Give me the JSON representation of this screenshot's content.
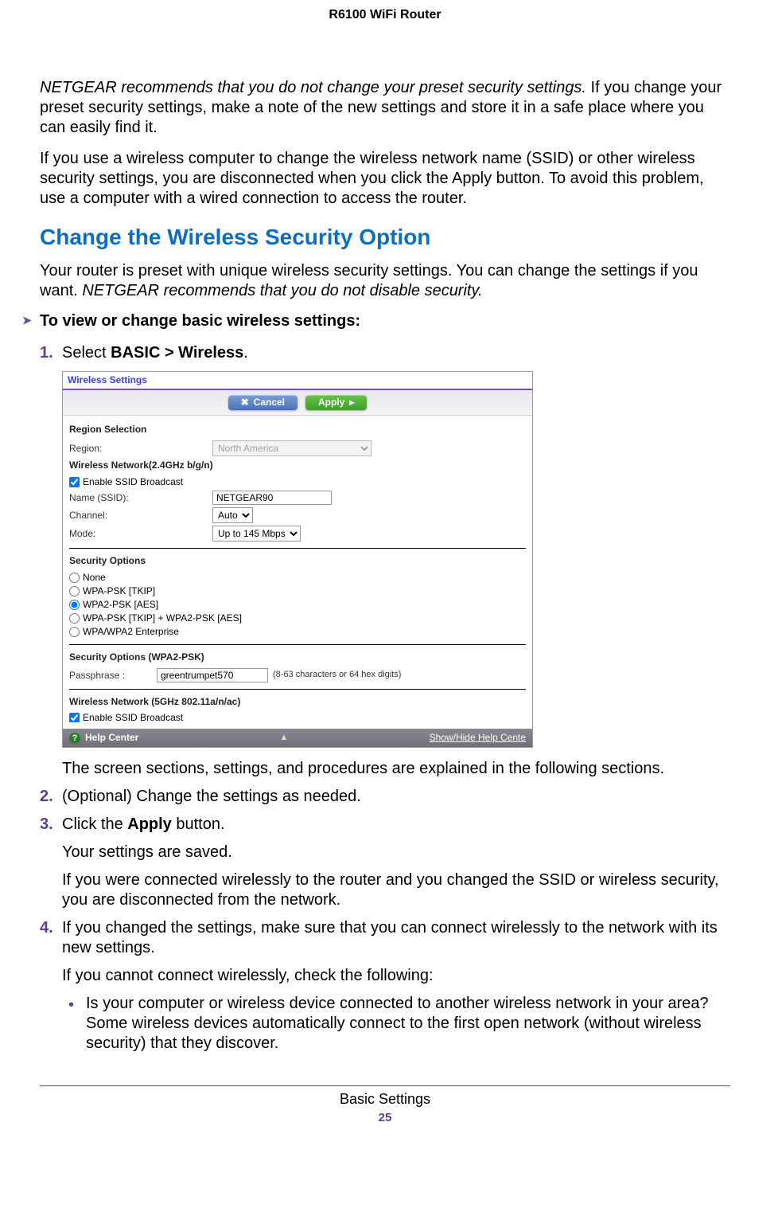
{
  "header": {
    "title": "R6100 WiFi Router"
  },
  "intro": {
    "rec_italic": "NETGEAR recommends that you do not change your preset security settings.",
    "rec_rest": " If you change your preset security settings, make a note of the new settings and store it in a safe place where you can easily find it.",
    "para2": "If you use a wireless computer to change the wireless network name (SSID) or other wireless security settings, you are disconnected when you click the Apply button. To avoid this problem, use a computer with a wired connection to access the router."
  },
  "section": {
    "heading": "Change the Wireless Security Option",
    "para1a": "Your router is preset with unique wireless security settings. You can change the settings if you want. ",
    "para1b": "NETGEAR recommends that you do not disable security."
  },
  "procedure": {
    "marker": "➤",
    "lead": "To view or change basic wireless settings:",
    "steps": {
      "s1": {
        "num": "1.",
        "text_a": "Select ",
        "text_b": "BASIC > Wireless",
        "text_c": "."
      },
      "caption": "The screen sections, settings, and procedures are explained in the following sections.",
      "s2": {
        "num": "2.",
        "text": "(Optional) Change the settings as needed."
      },
      "s3": {
        "num": "3.",
        "text_a": "Click the ",
        "text_b": "Apply",
        "text_c": " button.",
        "p1": "Your settings are saved.",
        "p2": "If you were connected wirelessly to the router and you changed the SSID or wireless security, you are disconnected from the network."
      },
      "s4": {
        "num": "4.",
        "text": "If you changed the settings, make sure that you can connect wirelessly to the network with its new settings.",
        "p1": "If you cannot connect wirelessly, check the following:",
        "b1": "Is your computer or wireless device connected to another wireless network in your area? Some wireless devices automatically connect to the first open network (without wireless security) that they discover."
      }
    }
  },
  "screenshot": {
    "title": "Wireless Settings",
    "buttons": {
      "cancel": "Cancel",
      "apply": "Apply"
    },
    "region_section": "Region Selection",
    "region_label": "Region:",
    "region_value": "North America",
    "net24_heading": "Wireless Network(2.4GHz b/g/n)",
    "enable_ssid": "Enable SSID Broadcast",
    "name_label": "Name (SSID):",
    "name_value": "NETGEAR90",
    "channel_label": "Channel:",
    "channel_value": "Auto",
    "mode_label": "Mode:",
    "mode_value": "Up to 145 Mbps",
    "sec_options": "Security Options",
    "opt_none": "None",
    "opt_wpa_tkip": "WPA-PSK [TKIP]",
    "opt_wpa2_aes": "WPA2-PSK [AES]",
    "opt_mixed": "WPA-PSK [TKIP] + WPA2-PSK [AES]",
    "opt_enterprise": "WPA/WPA2 Enterprise",
    "sec_wpa2": "Security Options (WPA2-PSK)",
    "pass_label": "Passphrase :",
    "pass_value": "greentrumpet570",
    "pass_note": "(8-63 characters or 64 hex digits)",
    "net5_heading": "Wireless Network (5GHz 802.11a/n/ac)",
    "enable_ssid_5g": "Enable SSID Broadcast",
    "help_center": "Help Center",
    "help_toggle": "Show/Hide Help Cente"
  },
  "footer": {
    "section": "Basic Settings",
    "page": "25"
  }
}
